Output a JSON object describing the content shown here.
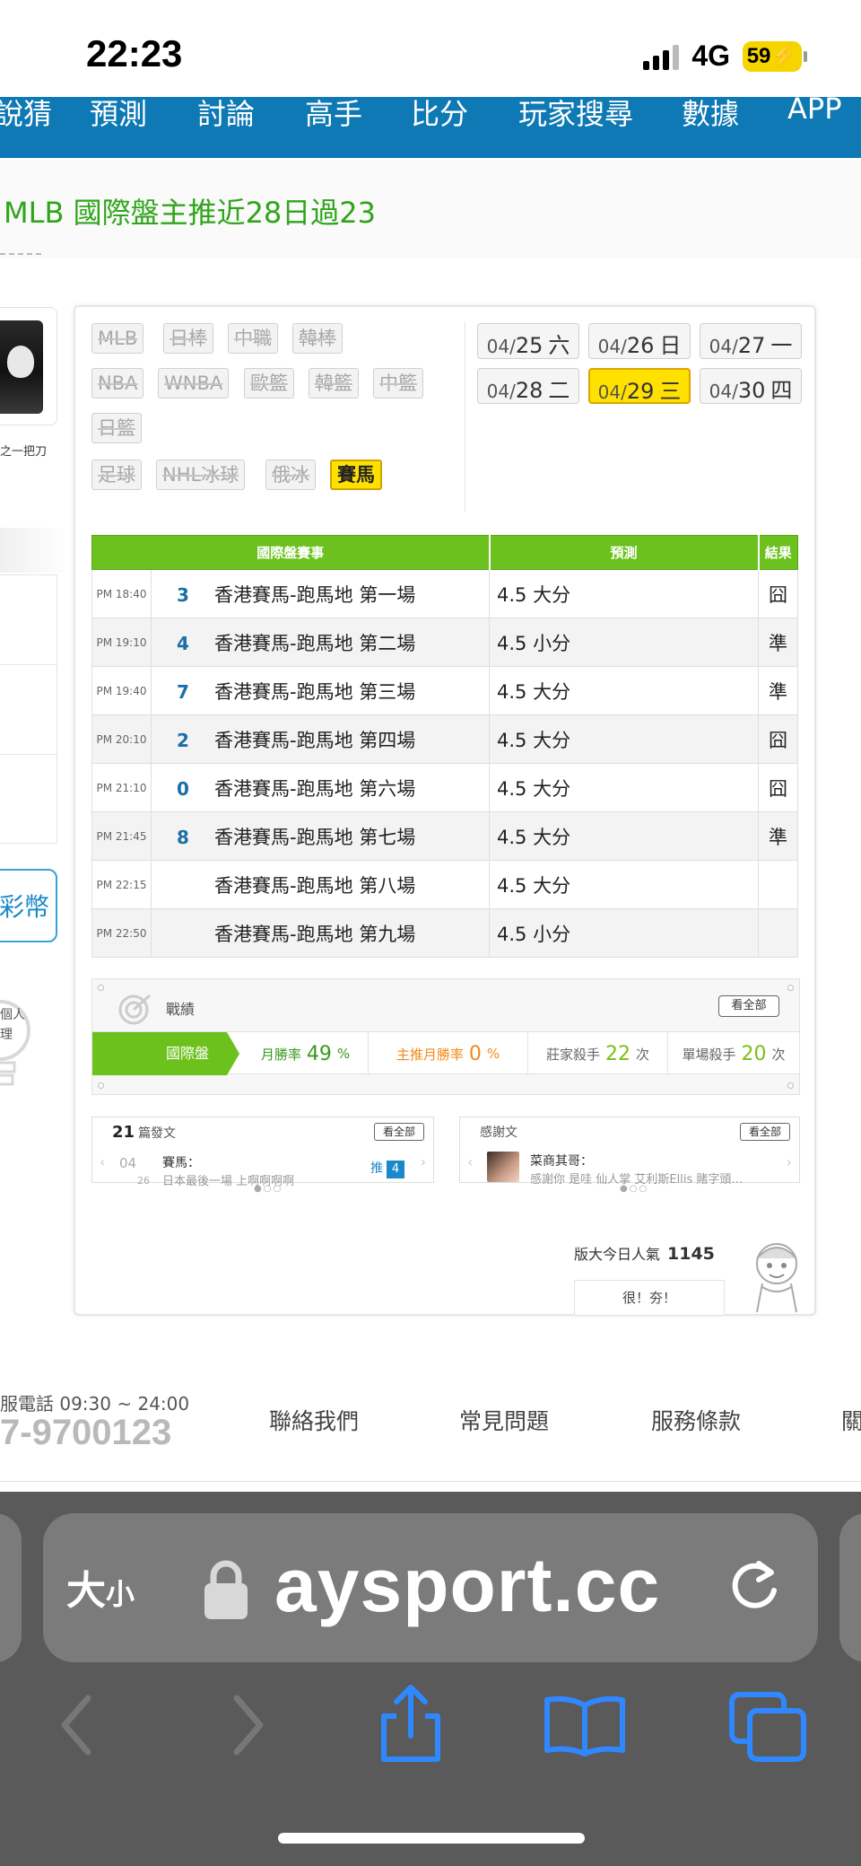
{
  "status_bar": {
    "time": "22:23",
    "network": "4G",
    "battery": "59"
  },
  "top_nav": {
    "items": [
      "說猜",
      "預測",
      "討論",
      "高手",
      "比分",
      "玩家搜尋",
      "數據",
      "APP"
    ]
  },
  "banner": {
    "title": "MLB 國際盤主推近28日過23"
  },
  "left_sidebar": {
    "user_name": "之一把刀",
    "coin_label": "彩幣",
    "tip_lines": [
      "個人",
      "理"
    ]
  },
  "sport_tags": [
    {
      "label": "MLB",
      "active": false
    },
    {
      "label": "日棒",
      "active": false
    },
    {
      "label": "中職",
      "active": false
    },
    {
      "label": "韓棒",
      "active": false
    },
    {
      "label": "NBA",
      "active": false
    },
    {
      "label": "WNBA",
      "active": false
    },
    {
      "label": "歐籃",
      "active": false
    },
    {
      "label": "韓籃",
      "active": false
    },
    {
      "label": "中籃",
      "active": false
    },
    {
      "label": "日籃",
      "active": false
    },
    {
      "label": "足球",
      "active": false
    },
    {
      "label": "NHL冰球",
      "active": false
    },
    {
      "label": "俄冰",
      "active": false
    },
    {
      "label": "賽馬",
      "active": true
    }
  ],
  "dates": [
    {
      "md": "04/",
      "day": "25",
      "weekday": "六",
      "active": false
    },
    {
      "md": "04/",
      "day": "26",
      "weekday": "日",
      "active": false
    },
    {
      "md": "04/",
      "day": "27",
      "weekday": "一",
      "active": false
    },
    {
      "md": "04/",
      "day": "28",
      "weekday": "二",
      "active": false
    },
    {
      "md": "04/",
      "day": "29",
      "weekday": "三",
      "active": true
    },
    {
      "md": "04/",
      "day": "30",
      "weekday": "四",
      "active": false
    }
  ],
  "table": {
    "headers": {
      "event": "國際盤賽事",
      "prediction": "預測",
      "result": "結果"
    },
    "rows": [
      {
        "time": "PM 18:40",
        "num": "3",
        "game": "香港賽馬-跑馬地 第一場",
        "pred": "4.5 大分",
        "result": "囧",
        "hit": false
      },
      {
        "time": "PM 19:10",
        "num": "4",
        "game": "香港賽馬-跑馬地 第二場",
        "pred": "4.5 小分",
        "result": "準",
        "hit": true
      },
      {
        "time": "PM 19:40",
        "num": "7",
        "game": "香港賽馬-跑馬地 第三場",
        "pred": "4.5 大分",
        "result": "準",
        "hit": true
      },
      {
        "time": "PM 20:10",
        "num": "2",
        "game": "香港賽馬-跑馬地 第四場",
        "pred": "4.5 大分",
        "result": "囧",
        "hit": false
      },
      {
        "time": "PM 21:10",
        "num": "0",
        "game": "香港賽馬-跑馬地 第六場",
        "pred": "4.5 大分",
        "result": "囧",
        "hit": false
      },
      {
        "time": "PM 21:45",
        "num": "8",
        "game": "香港賽馬-跑馬地 第七場",
        "pred": "4.5 大分",
        "result": "準",
        "hit": true
      },
      {
        "time": "PM 22:15",
        "num": "",
        "game": "香港賽馬-跑馬地 第八場",
        "pred": "4.5 大分",
        "result": "",
        "hit": false
      },
      {
        "time": "PM 22:50",
        "num": "",
        "game": "香港賽馬-跑馬地 第九場",
        "pred": "4.5 小分",
        "result": "",
        "hit": false
      }
    ]
  },
  "record": {
    "title": "戰績",
    "view_all": "看全部",
    "tab": "國際盤",
    "monthly_label": "月勝率",
    "monthly_value": "49",
    "main_label": "主推月勝率",
    "main_value": "0",
    "pct": "%",
    "banker_label": "莊家殺手",
    "banker_value": "22",
    "single_label": "單場殺手",
    "single_value": "20",
    "unit": "次"
  },
  "posts": {
    "count": "21",
    "label": "篇發文",
    "view_all": "看全部",
    "date_month": "04",
    "date_day": "26",
    "post_title": "賽馬：",
    "post_body": "日本最後一場 上啊啊啊啊",
    "push_label": "推",
    "push_count": "4"
  },
  "thanks": {
    "label": "感謝文",
    "view_all": "看全部",
    "user": "菜商其哥：",
    "body": "感謝你 是哇 仙人掌 艾利斯Ellis 賭字頭…"
  },
  "popularity": {
    "label": "版大今日人氣",
    "value": "1145"
  },
  "praise_label": "很！夯！",
  "footer": {
    "hours": "服電話 09:30 ~ 24:00",
    "phone": "7-9700123",
    "links": [
      "聯絡我們",
      "常見問題",
      "服務條款",
      "關"
    ]
  },
  "safari": {
    "text_size": "大",
    "text_size_small": "小",
    "url": "aysport.cc"
  },
  "colors": {
    "nav_blue": "#0e79b4",
    "green": "#6dc11e",
    "highlight": "#ffe100",
    "title_green": "#2fa51a"
  }
}
